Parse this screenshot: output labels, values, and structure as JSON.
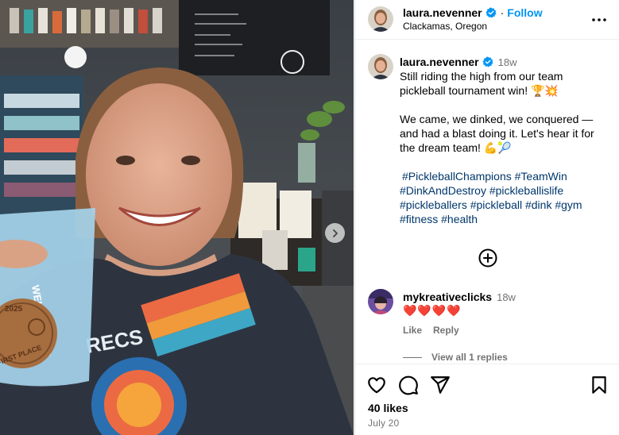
{
  "post": {
    "author": "laura.nevenner",
    "location": "Clackamas, Oregon",
    "follow_label": "Follow",
    "dot": "·",
    "caption_time": "18w",
    "caption_text": "Still riding the high from our team pickleball tournament win! 🏆💥\n\nWe came, we dinked, we conquered — and had a blast doing it. Let's hear it for the dream team! 💪🎾",
    "hashtags": [
      "#PickleballChampions",
      "#TeamWin",
      "#DinkAndDestroy",
      "#pickleballislife",
      "#pickleballers",
      "#pickleball",
      "#dink",
      "#gym",
      "#fitness",
      "#health"
    ],
    "likes": "40 likes",
    "date": "July 20"
  },
  "comment": {
    "user": "mykreativeclicks",
    "time": "18w",
    "text": "❤️❤️❤️❤️",
    "like_label": "Like",
    "reply_label": "Reply",
    "view_replies": "View all 1 replies"
  },
  "photo": {
    "tag_text_top": "2025",
    "tag_text_bottom": "FIRST PLACE",
    "shirt_text": "RECS",
    "cup_text": "WELL PLAYED"
  },
  "colors": {
    "accent": "#0095f6",
    "hashtag": "#00376b",
    "muted": "#737373",
    "border": "#dbdbdb"
  },
  "icons": [
    "verified-badge-icon",
    "more-options-icon",
    "add-comment-icon",
    "heart-icon",
    "comment-icon",
    "share-icon",
    "bookmark-icon",
    "chevron-right-icon"
  ]
}
